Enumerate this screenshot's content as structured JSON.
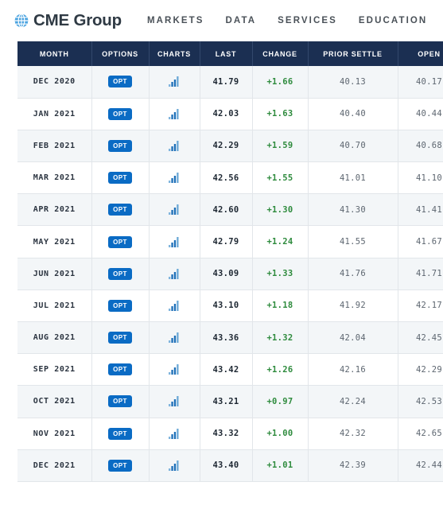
{
  "header": {
    "logo_icon": "globe-icon",
    "brand": "CME Group",
    "nav": [
      {
        "label": "MARKETS"
      },
      {
        "label": "DATA"
      },
      {
        "label": "SERVICES"
      },
      {
        "label": "EDUCATION"
      }
    ]
  },
  "colors": {
    "header_bg": "#1b2f52",
    "badge_blue": "#0a6bc4",
    "change_green": "#2e8b3d",
    "row_stripe": "#f3f6f8",
    "logo_blue": "#3f9ad8"
  },
  "table": {
    "columns": [
      "MONTH",
      "OPTIONS",
      "CHARTS",
      "LAST",
      "CHANGE",
      "PRIOR SETTLE",
      "OPEN",
      ""
    ],
    "option_label": "OPT",
    "chart_icon": "bar-chart-icon",
    "rows": [
      {
        "month": "DEC 2020",
        "options": "OPT",
        "last": "41.79",
        "change": "+1.66",
        "prior_settle": "40.13",
        "open": "40.17"
      },
      {
        "month": "JAN 2021",
        "options": "OPT",
        "last": "42.03",
        "change": "+1.63",
        "prior_settle": "40.40",
        "open": "40.44"
      },
      {
        "month": "FEB 2021",
        "options": "OPT",
        "last": "42.29",
        "change": "+1.59",
        "prior_settle": "40.70",
        "open": "40.68"
      },
      {
        "month": "MAR 2021",
        "options": "OPT",
        "last": "42.56",
        "change": "+1.55",
        "prior_settle": "41.01",
        "open": "41.10"
      },
      {
        "month": "APR 2021",
        "options": "OPT",
        "last": "42.60",
        "change": "+1.30",
        "prior_settle": "41.30",
        "open": "41.41"
      },
      {
        "month": "MAY 2021",
        "options": "OPT",
        "last": "42.79",
        "change": "+1.24",
        "prior_settle": "41.55",
        "open": "41.67"
      },
      {
        "month": "JUN 2021",
        "options": "OPT",
        "last": "43.09",
        "change": "+1.33",
        "prior_settle": "41.76",
        "open": "41.71"
      },
      {
        "month": "JUL 2021",
        "options": "OPT",
        "last": "43.10",
        "change": "+1.18",
        "prior_settle": "41.92",
        "open": "42.17"
      },
      {
        "month": "AUG 2021",
        "options": "OPT",
        "last": "43.36",
        "change": "+1.32",
        "prior_settle": "42.04",
        "open": "42.45"
      },
      {
        "month": "SEP 2021",
        "options": "OPT",
        "last": "43.42",
        "change": "+1.26",
        "prior_settle": "42.16",
        "open": "42.29"
      },
      {
        "month": "OCT 2021",
        "options": "OPT",
        "last": "43.21",
        "change": "+0.97",
        "prior_settle": "42.24",
        "open": "42.53"
      },
      {
        "month": "NOV 2021",
        "options": "OPT",
        "last": "43.32",
        "change": "+1.00",
        "prior_settle": "42.32",
        "open": "42.65"
      },
      {
        "month": "DEC 2021",
        "options": "OPT",
        "last": "43.40",
        "change": "+1.01",
        "prior_settle": "42.39",
        "open": "42.44"
      }
    ]
  }
}
